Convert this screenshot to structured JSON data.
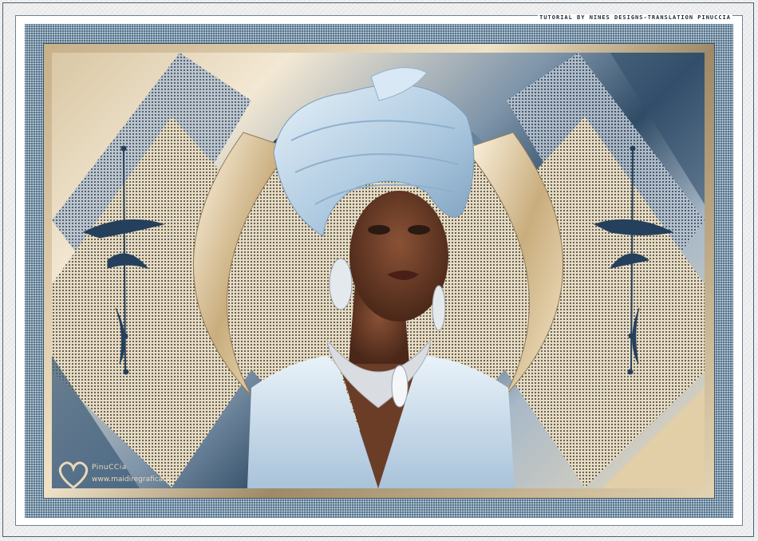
{
  "credit_line": "TUTORIAL BY NINES DESIGNS-TRANSLATION PINUCCIA",
  "signature": {
    "name": "PinuCCia",
    "url": "www.maidiregrafica.eu"
  },
  "colors": {
    "frame_blue": "#4a6a84",
    "gold": "#d8c39d",
    "turban": "#b9d3e6",
    "skin": "#5a3322"
  },
  "icons": [
    "heart-logo-icon",
    "ink-splash-ornament-icon"
  ]
}
